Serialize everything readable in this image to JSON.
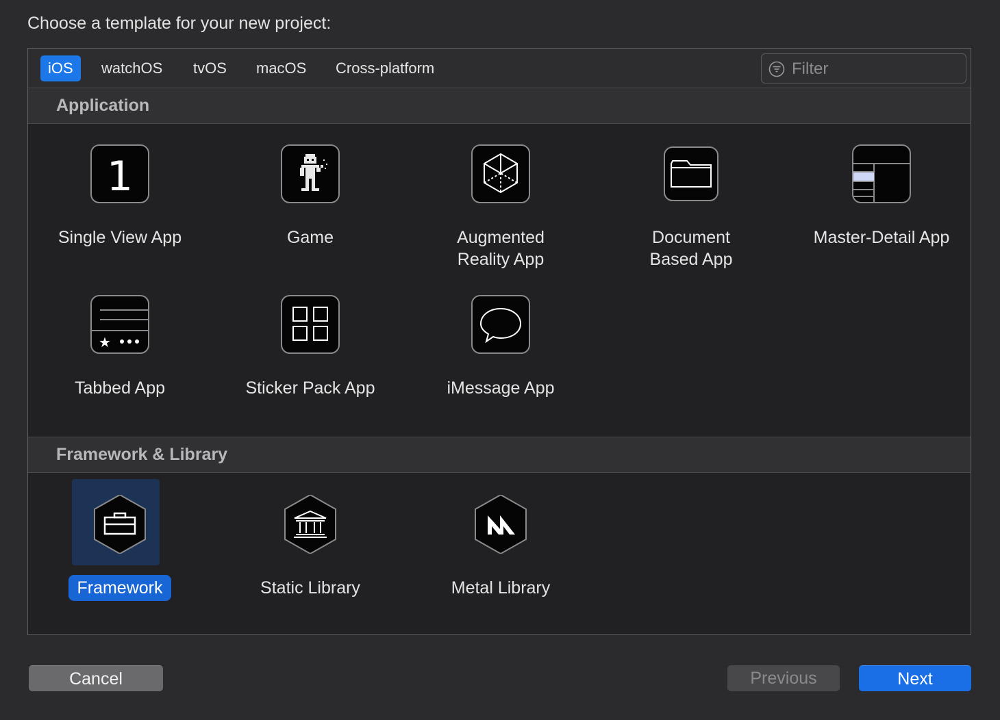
{
  "dialog": {
    "heading": "Choose a template for your new project:"
  },
  "tabs": [
    {
      "label": "iOS",
      "selected": true
    },
    {
      "label": "watchOS",
      "selected": false
    },
    {
      "label": "tvOS",
      "selected": false
    },
    {
      "label": "macOS",
      "selected": false
    },
    {
      "label": "Cross-platform",
      "selected": false
    }
  ],
  "filter": {
    "placeholder": "Filter",
    "value": ""
  },
  "sections": [
    {
      "title": "Application",
      "items": [
        {
          "label": "Single View App",
          "icon": "single-view-app-icon"
        },
        {
          "label": "Game",
          "icon": "game-icon"
        },
        {
          "label": "Augmented\nReality App",
          "icon": "augmented-reality-icon"
        },
        {
          "label": "Document\nBased App",
          "icon": "folder-icon"
        },
        {
          "label": "Master-Detail App",
          "icon": "master-detail-icon"
        },
        {
          "label": "Tabbed App",
          "icon": "tabbed-app-icon"
        },
        {
          "label": "Sticker Pack App",
          "icon": "sticker-pack-icon"
        },
        {
          "label": "iMessage App",
          "icon": "message-bubble-icon"
        }
      ]
    },
    {
      "title": "Framework & Library",
      "items": [
        {
          "label": "Framework",
          "icon": "toolbox-icon",
          "selected": true
        },
        {
          "label": "Static Library",
          "icon": "library-building-icon"
        },
        {
          "label": "Metal Library",
          "icon": "metal-icon"
        }
      ]
    }
  ],
  "buttons": {
    "cancel": "Cancel",
    "previous": "Previous",
    "next": "Next"
  },
  "colors": {
    "accent": "#1c78e8",
    "selection_bg": "#1d3356",
    "background": "#2b2b2d"
  }
}
